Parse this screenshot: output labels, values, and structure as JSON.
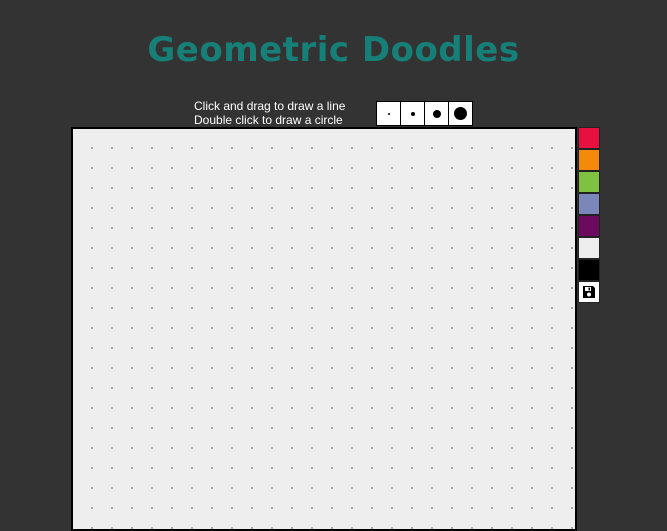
{
  "header": {
    "title": "Geometric Doodles"
  },
  "instructions": {
    "line1": "Click and drag to draw a line",
    "line2": "Double click to draw a circle"
  },
  "brush_sizes": [
    {
      "name": "tiny",
      "level": 1
    },
    {
      "name": "small",
      "level": 2
    },
    {
      "name": "medium",
      "level": 3
    },
    {
      "name": "large",
      "level": 4
    }
  ],
  "palette": {
    "colors": [
      "#e8103f",
      "#f48a0c",
      "#7fc241",
      "#7b87b8",
      "#6b0a5f",
      "#eeeeee",
      "#000000"
    ],
    "save_icon": "floppy-disk-icon"
  },
  "canvas": {
    "background": "#eeeeee",
    "dot_color": "#9a9a9a"
  }
}
